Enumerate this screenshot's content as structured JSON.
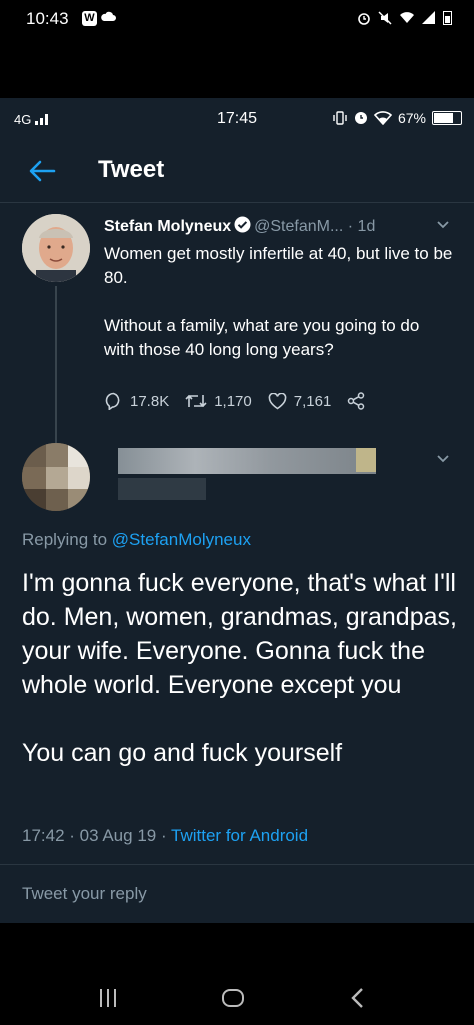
{
  "outer_status": {
    "time": "10:43",
    "app_badge": "W"
  },
  "inner_status": {
    "network": "4G",
    "time": "17:45",
    "battery": "67%"
  },
  "header": {
    "title": "Tweet"
  },
  "tweet": {
    "name": "Stefan Molyneux",
    "handle": "@StefanM...",
    "sep": "·",
    "time": "1d",
    "text": "Women get mostly infertile at 40, but live to be 80.\n\nWithout a family, what are you going to do with those 40 long long years?",
    "replies": "17.8K",
    "retweets": "1,170",
    "likes": "7,161"
  },
  "reply": {
    "replying_prefix": "Replying to",
    "replying_handle": "@StefanMolyneux",
    "text": "I'm gonna fuck everyone, that's what I'll do. Men, women, grandmas, grandpas, your wife. Everyone. Gonna fuck the whole world. Everyone except you\n\nYou can go and fuck yourself",
    "meta": "17:42 · 03 Aug 19 ·",
    "source": "Twitter for Android"
  },
  "compose": {
    "placeholder": "Tweet your reply"
  },
  "colors": {
    "background": "#15202b",
    "accent": "#1da1f2",
    "muted": "#8899a6"
  }
}
